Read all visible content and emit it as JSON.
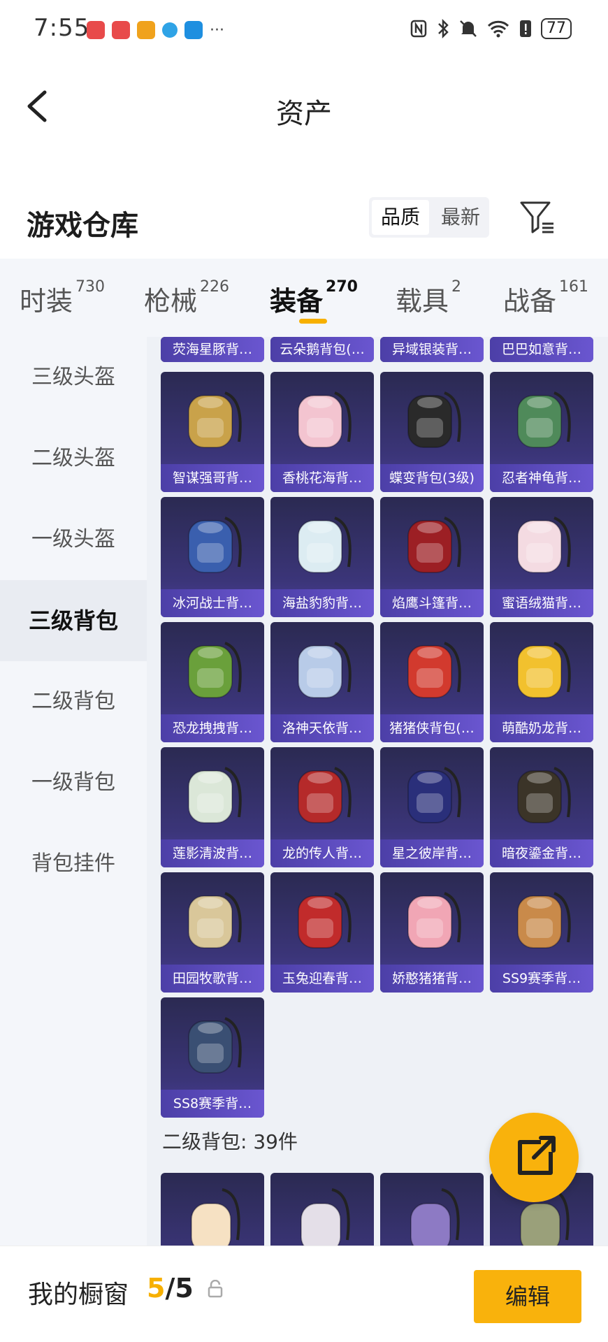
{
  "status_bar": {
    "time": "7:55",
    "more": "···",
    "battery": "77"
  },
  "header": {
    "title": "资产"
  },
  "warehouse": {
    "title": "游戏仓库",
    "sort_options": [
      "品质",
      "最新"
    ],
    "sort_selected": "品质"
  },
  "tabs": [
    {
      "label": "时装",
      "count": "730"
    },
    {
      "label": "枪械",
      "count": "226"
    },
    {
      "label": "装备",
      "count": "270",
      "active": true
    },
    {
      "label": "载具",
      "count": "2"
    },
    {
      "label": "战备",
      "count": "161"
    }
  ],
  "side_nav": [
    "三级头盔",
    "二级头盔",
    "一级头盔",
    "三级背包",
    "二级背包",
    "一级背包",
    "背包挂件"
  ],
  "side_nav_active": "三级背包",
  "top_strip_items": [
    "荧海星豚背…",
    "云朵鹅背包(…",
    "异域银装背…",
    "巴巴如意背…"
  ],
  "items": [
    {
      "name": "智谋强哥背…",
      "color": "#c9a24a"
    },
    {
      "name": "香桃花海背…",
      "color": "#f3c4d0"
    },
    {
      "name": "蝶变背包(3级)",
      "color": "#2a2a2a"
    },
    {
      "name": "忍者神龟背…",
      "color": "#4f8a5a"
    },
    {
      "name": "冰河战士背…",
      "color": "#3a5fae"
    },
    {
      "name": "海盐豹豹背…",
      "color": "#dcecf2"
    },
    {
      "name": "焰鹰斗篷背…",
      "color": "#9c1f24"
    },
    {
      "name": "蜜语绒猫背…",
      "color": "#f4dbe2"
    },
    {
      "name": "恐龙拽拽背…",
      "color": "#6aa03b"
    },
    {
      "name": "洛神天依背…",
      "color": "#b8cbe8"
    },
    {
      "name": "猪猪侠背包(…",
      "color": "#d23a2e"
    },
    {
      "name": "萌酷奶龙背…",
      "color": "#f2c12e"
    },
    {
      "name": "莲影清波背…",
      "color": "#dbe7d8"
    },
    {
      "name": "龙的传人背…",
      "color": "#b52a2a"
    },
    {
      "name": "星之彼岸背…",
      "color": "#2a2f7a"
    },
    {
      "name": "暗夜鎏金背…",
      "color": "#3b3428"
    },
    {
      "name": "田园牧歌背…",
      "color": "#d9c79a"
    },
    {
      "name": "玉兔迎春背…",
      "color": "#c12b2b"
    },
    {
      "name": "娇憨猪猪背…",
      "color": "#f1a6b5"
    },
    {
      "name": "SS9赛季背…",
      "color": "#c98a4a"
    },
    {
      "name": "SS8赛季背…",
      "color": "#3a4f73"
    }
  ],
  "section_two": {
    "heading": "二级背包: 39件"
  },
  "section_two_items": [
    {
      "color": "#f6e1c3"
    },
    {
      "color": "#e4dfe8"
    },
    {
      "color": "#8d7ac4"
    },
    {
      "color": "#9aa07a"
    }
  ],
  "bottom": {
    "showcase_label": "我的橱窗",
    "count_current": "5",
    "count_sep": "/",
    "count_total": "5",
    "edit_label": "编辑"
  },
  "colors": {
    "accent": "#f9b20c",
    "card_label": "#5a49bd"
  }
}
